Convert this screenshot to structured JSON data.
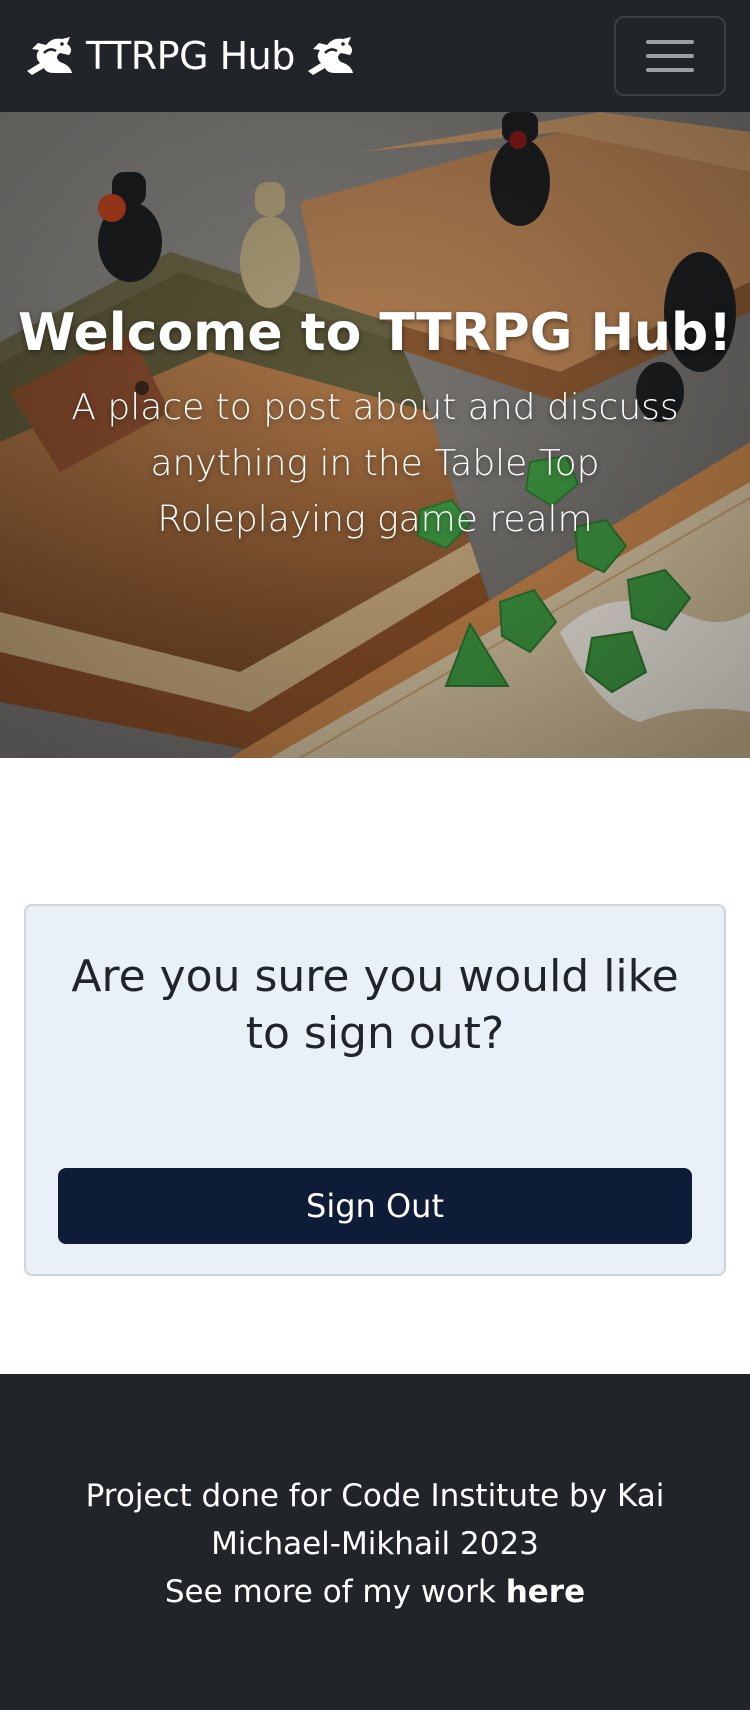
{
  "navbar": {
    "brand": "TTRPG Hub",
    "left_icon": "dragon-icon",
    "right_icon": "dragon-icon",
    "toggler_icon": "hamburger-icon"
  },
  "hero": {
    "title": "Welcome to TTRPG Hub!",
    "subtitle": "A place to post about and discuss anything in the Table Top Roleplaying game realm"
  },
  "signout": {
    "question": "Are you sure you would like to sign out?",
    "button_label": "Sign Out",
    "button_color": "#0f1c38"
  },
  "footer": {
    "credit": "Project done for Code Institute by Kai Michael-Mikhail 2023",
    "more_prefix": "See more of my work",
    "link_label": "here"
  },
  "colors": {
    "navbar_bg": "#212529",
    "card_bg": "#eaf0f8",
    "footer_bg": "#212529"
  }
}
